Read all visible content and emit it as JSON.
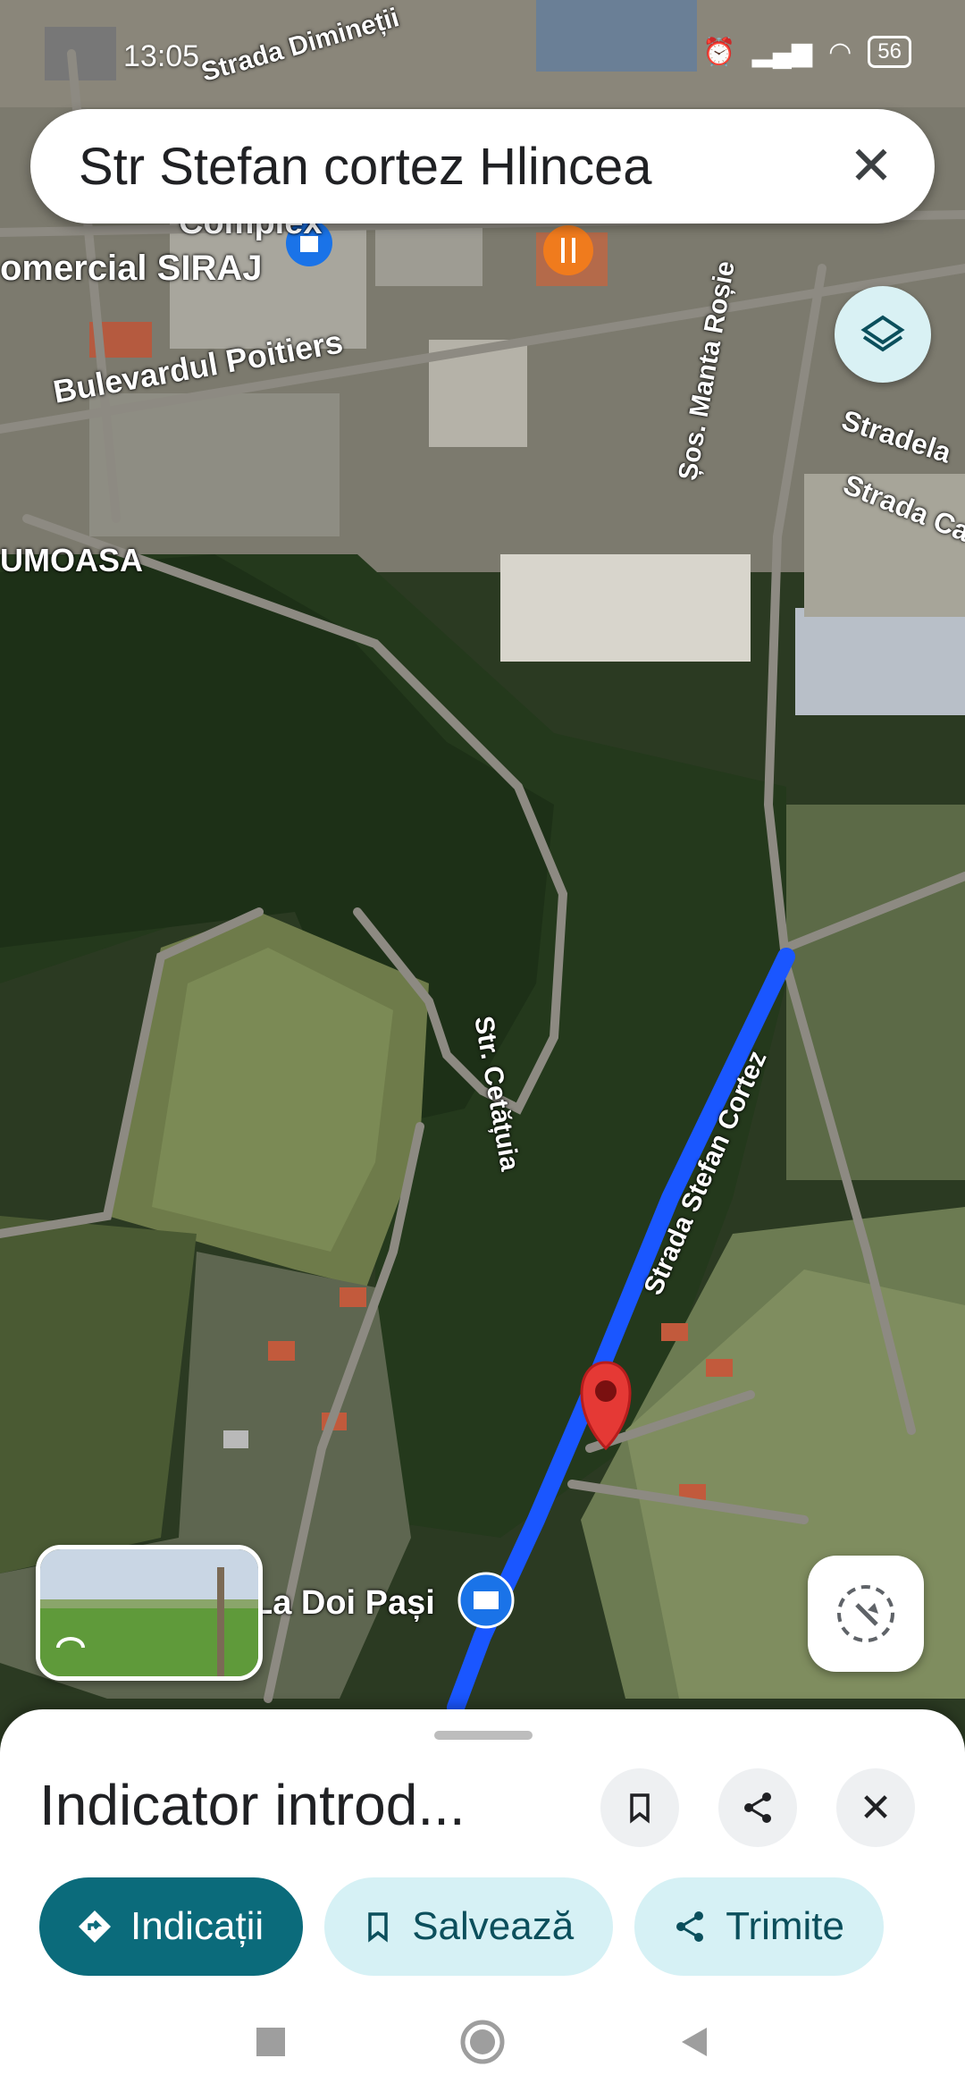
{
  "status_bar": {
    "time": "13:05",
    "battery": "56"
  },
  "search": {
    "query": "Str Stefan cortez Hlincea"
  },
  "map": {
    "labels": {
      "street_top": "Strada Dimineții",
      "complex": "Complex",
      "comercial": "omercial SIRAJ",
      "bulevard": "Bulevardul Poitiers",
      "area": "UMOASA",
      "manta": "Șos. Manta Roșie",
      "stradela": "Stradela",
      "strada_ca": "Strada Ca",
      "cetatuia": "Str. Cetățuia",
      "stefan": "Strada Stefan Cortez",
      "shop": "La Doi Pași"
    }
  },
  "sheet": {
    "title": "Indicator introd...",
    "directions_label": "Indicații",
    "save_label": "Salvează",
    "share_label": "Trimite"
  }
}
